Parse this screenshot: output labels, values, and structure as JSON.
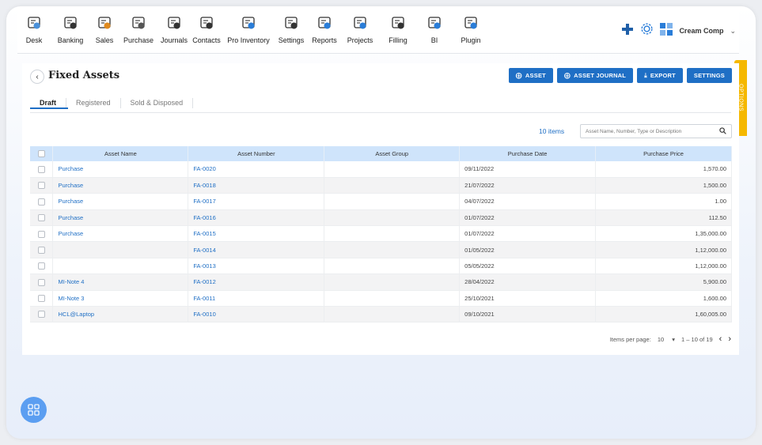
{
  "nav": {
    "items": [
      {
        "label": "Desk",
        "icon": "desk-icon"
      },
      {
        "label": "Banking",
        "icon": "bank-icon"
      },
      {
        "label": "Sales",
        "icon": "sales-icon"
      },
      {
        "label": "Purchase",
        "icon": "purchase-icon"
      },
      {
        "label": "Journals",
        "icon": "journals-icon"
      },
      {
        "label": "Contacts",
        "icon": "contacts-icon"
      },
      {
        "label": "Pro Inventory",
        "icon": "inventory-icon"
      },
      {
        "label": "Settings",
        "icon": "settings-tools-icon"
      },
      {
        "label": "Reports",
        "icon": "reports-icon"
      },
      {
        "label": "Projects",
        "icon": "projects-icon"
      },
      {
        "label": "Filling",
        "icon": "filling-icon"
      },
      {
        "label": "BI",
        "icon": "bi-icon"
      },
      {
        "label": "Plugin",
        "icon": "plugin-icon"
      }
    ],
    "company": "Cream Comp"
  },
  "options_label": "OPTIONS",
  "page": {
    "title": "Fixed Assets",
    "actions": {
      "asset": "ASSET",
      "asset_journal": "ASSET JOURNAL",
      "export": "EXPORT",
      "settings": "SETTINGS"
    },
    "tabs": [
      "Draft",
      "Registered",
      "Sold & Disposed"
    ],
    "count": "10 items",
    "search_placeholder": "Asset Name, Number, Type or Description"
  },
  "table": {
    "columns": [
      "Asset Name",
      "Asset Number",
      "Asset Group",
      "Purchase Date",
      "Purchase Price"
    ],
    "rows": [
      {
        "name": "Purchase",
        "number": "FA-0020",
        "group": "",
        "date": "09/11/2022",
        "price": "1,570.00"
      },
      {
        "name": "Purchase",
        "number": "FA-0018",
        "group": "",
        "date": "21/07/2022",
        "price": "1,500.00"
      },
      {
        "name": "Purchase",
        "number": "FA-0017",
        "group": "",
        "date": "04/07/2022",
        "price": "1.00"
      },
      {
        "name": "Purchase",
        "number": "FA-0016",
        "group": "",
        "date": "01/07/2022",
        "price": "112.50"
      },
      {
        "name": "Purchase",
        "number": "FA-0015",
        "group": "",
        "date": "01/07/2022",
        "price": "1,35,000.00"
      },
      {
        "name": "",
        "number": "FA-0014",
        "group": "",
        "date": "01/05/2022",
        "price": "1,12,000.00"
      },
      {
        "name": "",
        "number": "FA-0013",
        "group": "",
        "date": "05/05/2022",
        "price": "1,12,000.00"
      },
      {
        "name": "MI-Note 4",
        "number": "FA-0012",
        "group": "",
        "date": "28/04/2022",
        "price": "5,900.00"
      },
      {
        "name": "MI-Note 3",
        "number": "FA-0011",
        "group": "",
        "date": "25/10/2021",
        "price": "1,600.00"
      },
      {
        "name": "HCL@Laptop",
        "number": "FA-0010",
        "group": "",
        "date": "09/10/2021",
        "price": "1,60,005.00"
      }
    ]
  },
  "pager": {
    "label": "Items per page:",
    "per_page": "10",
    "range": "1 – 10 of 19"
  },
  "colors": {
    "primary": "#1f6fc5",
    "header_bg": "#cfe4fb",
    "options_tab": "#f5b800",
    "fab": "#5b9ef1"
  }
}
